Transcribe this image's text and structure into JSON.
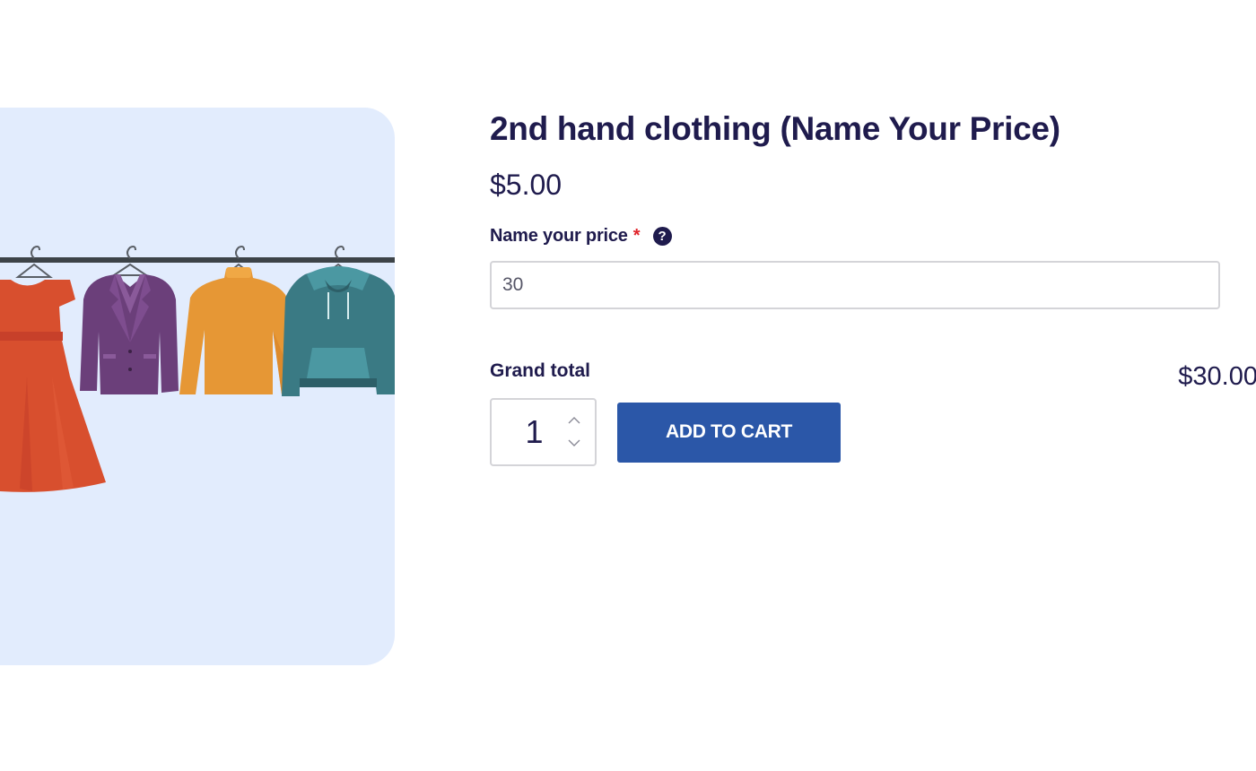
{
  "product": {
    "title": "2nd hand clothing (Name Your Price)",
    "price": "$5.00",
    "image_alt": "clothes-on-rack-image"
  },
  "name_your_price": {
    "label": "Name your price",
    "required_mark": "*",
    "help_glyph": "?",
    "help_icon": "question-circle-icon",
    "value": "30"
  },
  "grand_total": {
    "label": "Grand total",
    "value": "$30.00"
  },
  "cart": {
    "quantity": "1",
    "add_label": "ADD TO CART"
  },
  "colors": {
    "text": "#1f1b4d",
    "button": "#2b57a8",
    "required": "#e0242b",
    "image_bg": "#e2ecfd"
  }
}
